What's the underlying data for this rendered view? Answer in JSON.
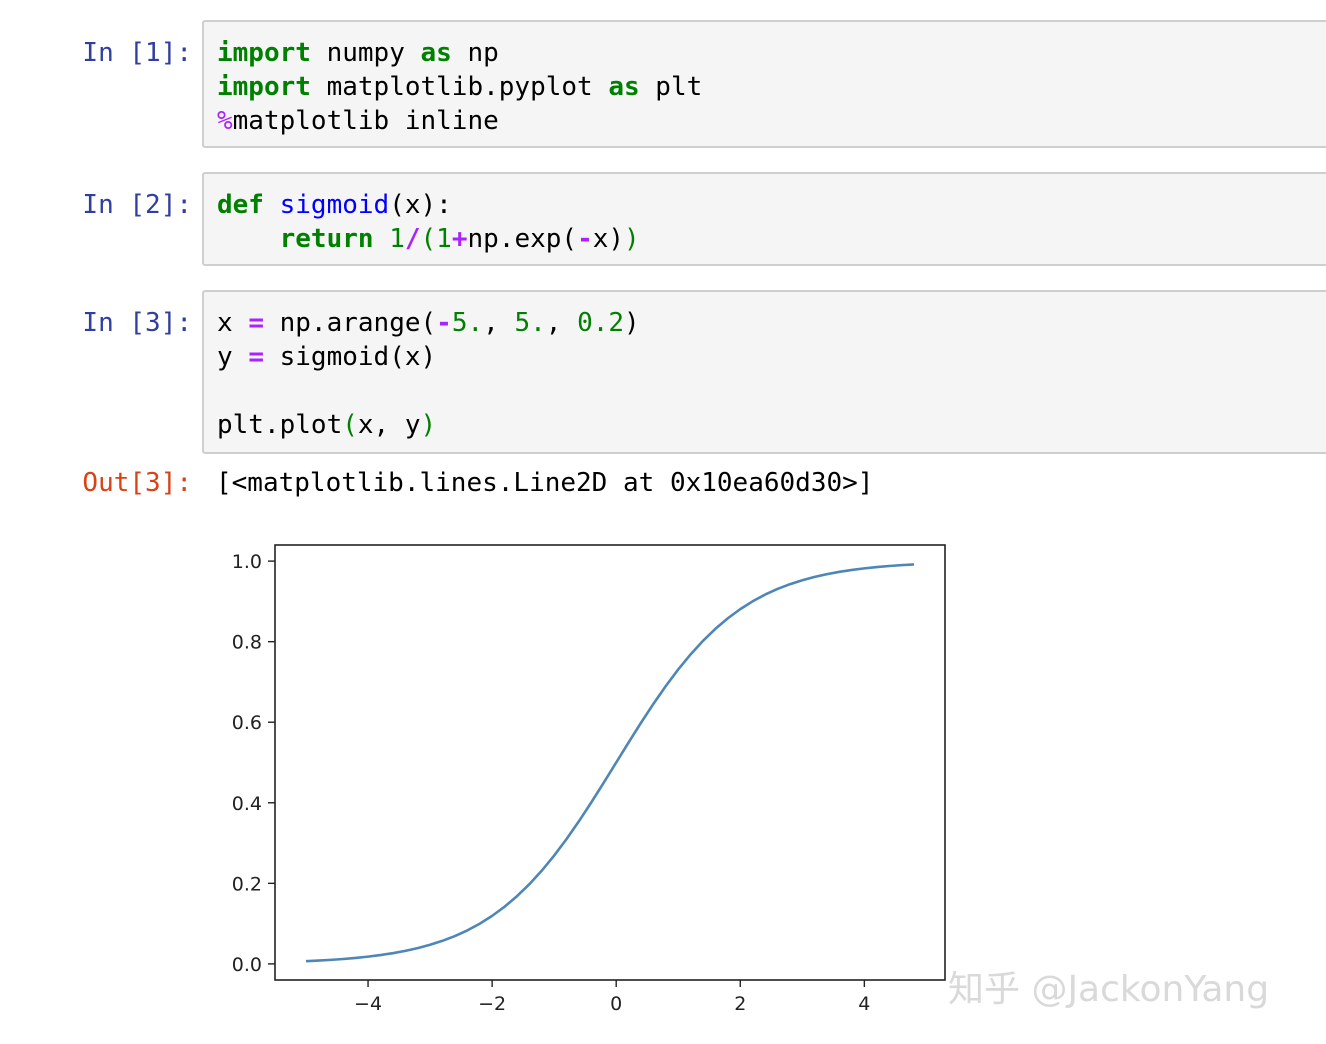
{
  "cells": [
    {
      "prompt": "In [1]:",
      "lines": [
        "import numpy as np",
        "import matplotlib.pyplot as plt",
        "%matplotlib inline"
      ]
    },
    {
      "prompt": "In [2]:",
      "lines": [
        "def sigmoid(x):",
        "    return 1/(1+np.exp(-x))"
      ]
    },
    {
      "prompt": "In [3]:",
      "lines": [
        "x = np.arange(-5., 5., 0.2)",
        "y = sigmoid(x)",
        "",
        "plt.plot(x, y)"
      ]
    }
  ],
  "output": {
    "prompt": "Out[3]:",
    "text": "[<matplotlib.lines.Line2D at 0x10ea60d30>]"
  },
  "chart_data": {
    "type": "line",
    "x_function": "sigmoid",
    "x_start": -5.0,
    "x_stop": 4.8,
    "x_step": 0.2,
    "xlim": [
      -5.5,
      5.3
    ],
    "ylim": [
      -0.04,
      1.04
    ],
    "xticks": [
      -4,
      -2,
      0,
      2,
      4
    ],
    "xtick_labels": [
      "−4",
      "−2",
      "0",
      "2",
      "4"
    ],
    "yticks": [
      0.0,
      0.2,
      0.4,
      0.6,
      0.8,
      1.0
    ],
    "ytick_labels": [
      "0.0",
      "0.2",
      "0.4",
      "0.6",
      "0.8",
      "1.0"
    ],
    "line_color": "#4e86b8",
    "grid": false
  },
  "watermark": "知乎 @JackonYang"
}
